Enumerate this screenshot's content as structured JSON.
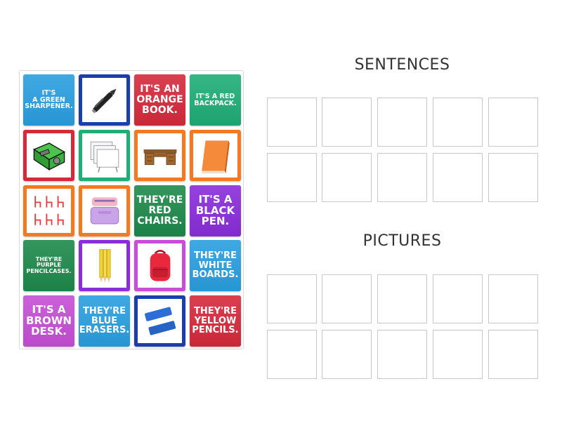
{
  "colors": {
    "blue": "#2a9fe0",
    "red": "#d62a3c",
    "teal": "#1fae77",
    "green": "#1e8a4b",
    "orange": "#f47a22",
    "purple": "#8a2ddb",
    "pink": "#c64fd6",
    "navy": "#1b3fa8"
  },
  "headings": {
    "sentences": "SENTENCES",
    "pictures": "PICTURES"
  },
  "cards": [
    {
      "kind": "text",
      "text": "IT'S\nA GREEN\nSHARPENER.",
      "color": "blue",
      "size": 9.5
    },
    {
      "kind": "image",
      "icon": "pen-icon",
      "color": "navy"
    },
    {
      "kind": "text",
      "text": "IT'S AN\nORANGE\nBOOK.",
      "color": "red",
      "size": 14
    },
    {
      "kind": "text",
      "text": "IT'S A RED\nBACKPACK.",
      "color": "teal",
      "size": 9.5
    },
    {
      "kind": "image",
      "icon": "sharpener-icon",
      "color": "red"
    },
    {
      "kind": "image",
      "icon": "whiteboards-icon",
      "color": "teal"
    },
    {
      "kind": "image",
      "icon": "desk-icon",
      "color": "orange"
    },
    {
      "kind": "image",
      "icon": "book-icon",
      "color": "orange"
    },
    {
      "kind": "image",
      "icon": "chairs-icon",
      "color": "orange"
    },
    {
      "kind": "image",
      "icon": "pencilcase-icon",
      "color": "orange"
    },
    {
      "kind": "text",
      "text": "THEY'RE\nRED\nCHAIRS.",
      "color": "green",
      "size": 14
    },
    {
      "kind": "text",
      "text": "IT'S A\nBLACK\nPEN.",
      "color": "purple",
      "size": 15
    },
    {
      "kind": "text",
      "text": "THEY'RE\nPURPLE\nPENCILCASES.",
      "color": "green",
      "size": 8
    },
    {
      "kind": "image",
      "icon": "pencils-icon",
      "color": "purple"
    },
    {
      "kind": "image",
      "icon": "backpack-icon",
      "color": "pink"
    },
    {
      "kind": "text",
      "text": "THEY'RE\nWHITE\nBOARDS.",
      "color": "blue",
      "size": 13
    },
    {
      "kind": "text",
      "text": "IT'S A\nBROWN\nDESK.",
      "color": "pink",
      "size": 15
    },
    {
      "kind": "text",
      "text": "THEY'RE\nBLUE\nERASERS.",
      "color": "blue",
      "size": 13
    },
    {
      "kind": "image",
      "icon": "erasers-icon",
      "color": "navy"
    },
    {
      "kind": "text",
      "text": "THEY'RE\nYELLOW\nPENCILS.",
      "color": "red",
      "size": 13
    }
  ]
}
